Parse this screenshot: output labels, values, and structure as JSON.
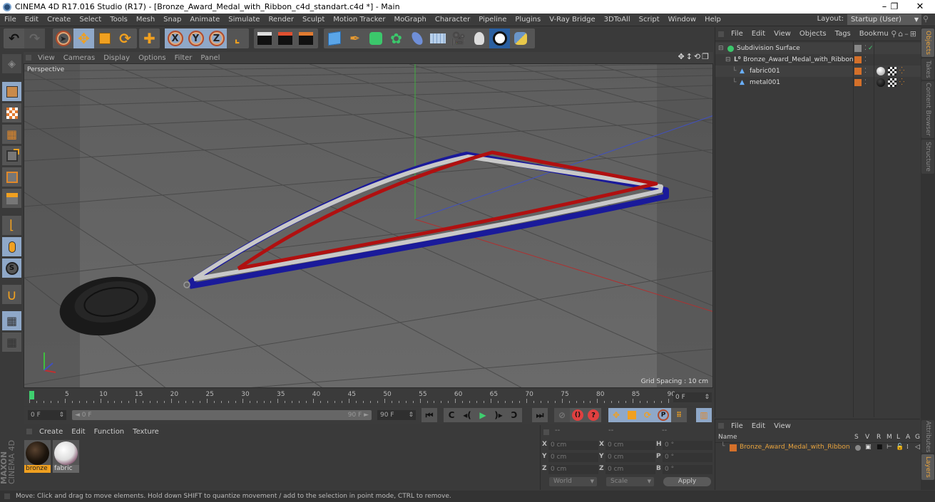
{
  "window": {
    "title": "CINEMA 4D R17.016 Studio (R17) - [Bronze_Award_Medal_with_Ribbon_c4d_standart.c4d *] - Main",
    "controls": {
      "minimize": "–",
      "maximize": "❐",
      "close": "✕"
    }
  },
  "menubar": {
    "items": [
      "File",
      "Edit",
      "Create",
      "Select",
      "Tools",
      "Mesh",
      "Snap",
      "Animate",
      "Simulate",
      "Render",
      "Sculpt",
      "Motion Tracker",
      "MoGraph",
      "Character",
      "Pipeline",
      "Plugins",
      "V-Ray Bridge",
      "3DToAll",
      "Script",
      "Window",
      "Help"
    ],
    "layout_label": "Layout:",
    "layout_value": "Startup (User)"
  },
  "toolbar": {
    "undo": "undo-icon",
    "redo": "redo-icon",
    "tools": [
      "live-selection",
      "move",
      "scale",
      "rotate",
      "recent-tool"
    ],
    "axis": [
      "X",
      "Y",
      "Z"
    ],
    "coord_system": "world-coordinates-icon",
    "render": [
      "render-view",
      "render-to-picture-viewer",
      "edit-render-settings"
    ],
    "objects": [
      "cube",
      "pen-spline",
      "subdivision-surface",
      "cloner-array",
      "deformer",
      "floor-environment",
      "camera",
      "light",
      "vray-logo",
      "python"
    ]
  },
  "viewport": {
    "menu": [
      "View",
      "Cameras",
      "Display",
      "Options",
      "Filter",
      "Panel"
    ],
    "camera_label": "Perspective",
    "grid_spacing": "Grid Spacing : 10 cm",
    "nav_icons": [
      "move-view-icon",
      "zoom-view-icon",
      "rotate-view-icon",
      "maximize-view-icon"
    ]
  },
  "left_tools": [
    "make-editable",
    "model-mode",
    "texture-mode",
    "workplane-mode",
    "points-mode",
    "edges-mode",
    "polygons-mode",
    "axis-mode",
    "tweak-mode",
    "solo-mode",
    "snap",
    "locked-workplane",
    "planar-workplane"
  ],
  "timeline": {
    "ticks": [
      0,
      5,
      10,
      15,
      20,
      25,
      30,
      35,
      40,
      45,
      50,
      55,
      60,
      65,
      70,
      75,
      80,
      85,
      90
    ],
    "min": 0,
    "max": 90,
    "current_frame": 0,
    "current_field": "0 F"
  },
  "transport": {
    "start_field": "0 F",
    "range_start": "◄ 0 F",
    "range_end": "90 F ►",
    "end_field": "90 F",
    "buttons": [
      "go-to-start",
      "go-to-previous-key",
      "play-backwards",
      "play-forwards",
      "go-to-next-key",
      "go-to-end"
    ]
  },
  "materials": {
    "menu": [
      "Create",
      "Edit",
      "Function",
      "Texture"
    ],
    "items": [
      {
        "name": "bronze",
        "selected": true
      },
      {
        "name": "fabric",
        "selected": false
      }
    ]
  },
  "coordinates": {
    "headers": [
      "--",
      "--",
      "--"
    ],
    "rows": [
      {
        "a1": "X",
        "v1": "0 cm",
        "a2": "X",
        "v2": "0 cm",
        "a3": "H",
        "v3": "0 °"
      },
      {
        "a1": "Y",
        "v1": "0 cm",
        "a2": "Y",
        "v2": "0 cm",
        "a3": "P",
        "v3": "0 °"
      },
      {
        "a1": "Z",
        "v1": "0 cm",
        "a2": "Z",
        "v2": "0 cm",
        "a3": "B",
        "v3": "0 °"
      }
    ],
    "mode_select": "World",
    "type_select": "Scale",
    "apply": "Apply"
  },
  "object_manager": {
    "menu": [
      "File",
      "Edit",
      "View",
      "Objects",
      "Tags",
      "Bookmarks"
    ],
    "menu_visible": [
      "File",
      "Edit",
      "View",
      "Objects",
      "Tags",
      "Bookmu"
    ],
    "objects": [
      {
        "name": "Subdivision Surface",
        "depth": 0
      },
      {
        "name": "Bronze_Award_Medal_with_Ribbon",
        "depth": 1
      },
      {
        "name": "fabric001",
        "depth": 2
      },
      {
        "name": "metal001",
        "depth": 2
      }
    ]
  },
  "right_tabs": {
    "top": [
      "Objects",
      "Takes",
      "Content Browser",
      "Structure"
    ],
    "bottom": [
      "Attributes",
      "Layers"
    ]
  },
  "layer_manager": {
    "menu": [
      "File",
      "Edit",
      "View"
    ],
    "columns": {
      "name": "Name",
      "flags": [
        "S",
        "V",
        "R",
        "M",
        "L",
        "A",
        "G"
      ]
    },
    "layers": [
      {
        "name": "Bronze_Award_Medal_with_Ribbon",
        "color": "#d4702a"
      }
    ]
  },
  "status": {
    "text": "Move: Click and drag to move elements. Hold down SHIFT to quantize movement / add to the selection in point mode, CTRL to remove."
  },
  "logo": {
    "line1": "MAXON",
    "line2": "CINEMA 4D"
  },
  "colors": {
    "accent_orange": "#d4702a",
    "selected_blue": "#8fa8c8",
    "active_tab_text": "#e8a33d",
    "layer_text": "#e8a33d",
    "timeline_marker": "#3fcf6f"
  }
}
